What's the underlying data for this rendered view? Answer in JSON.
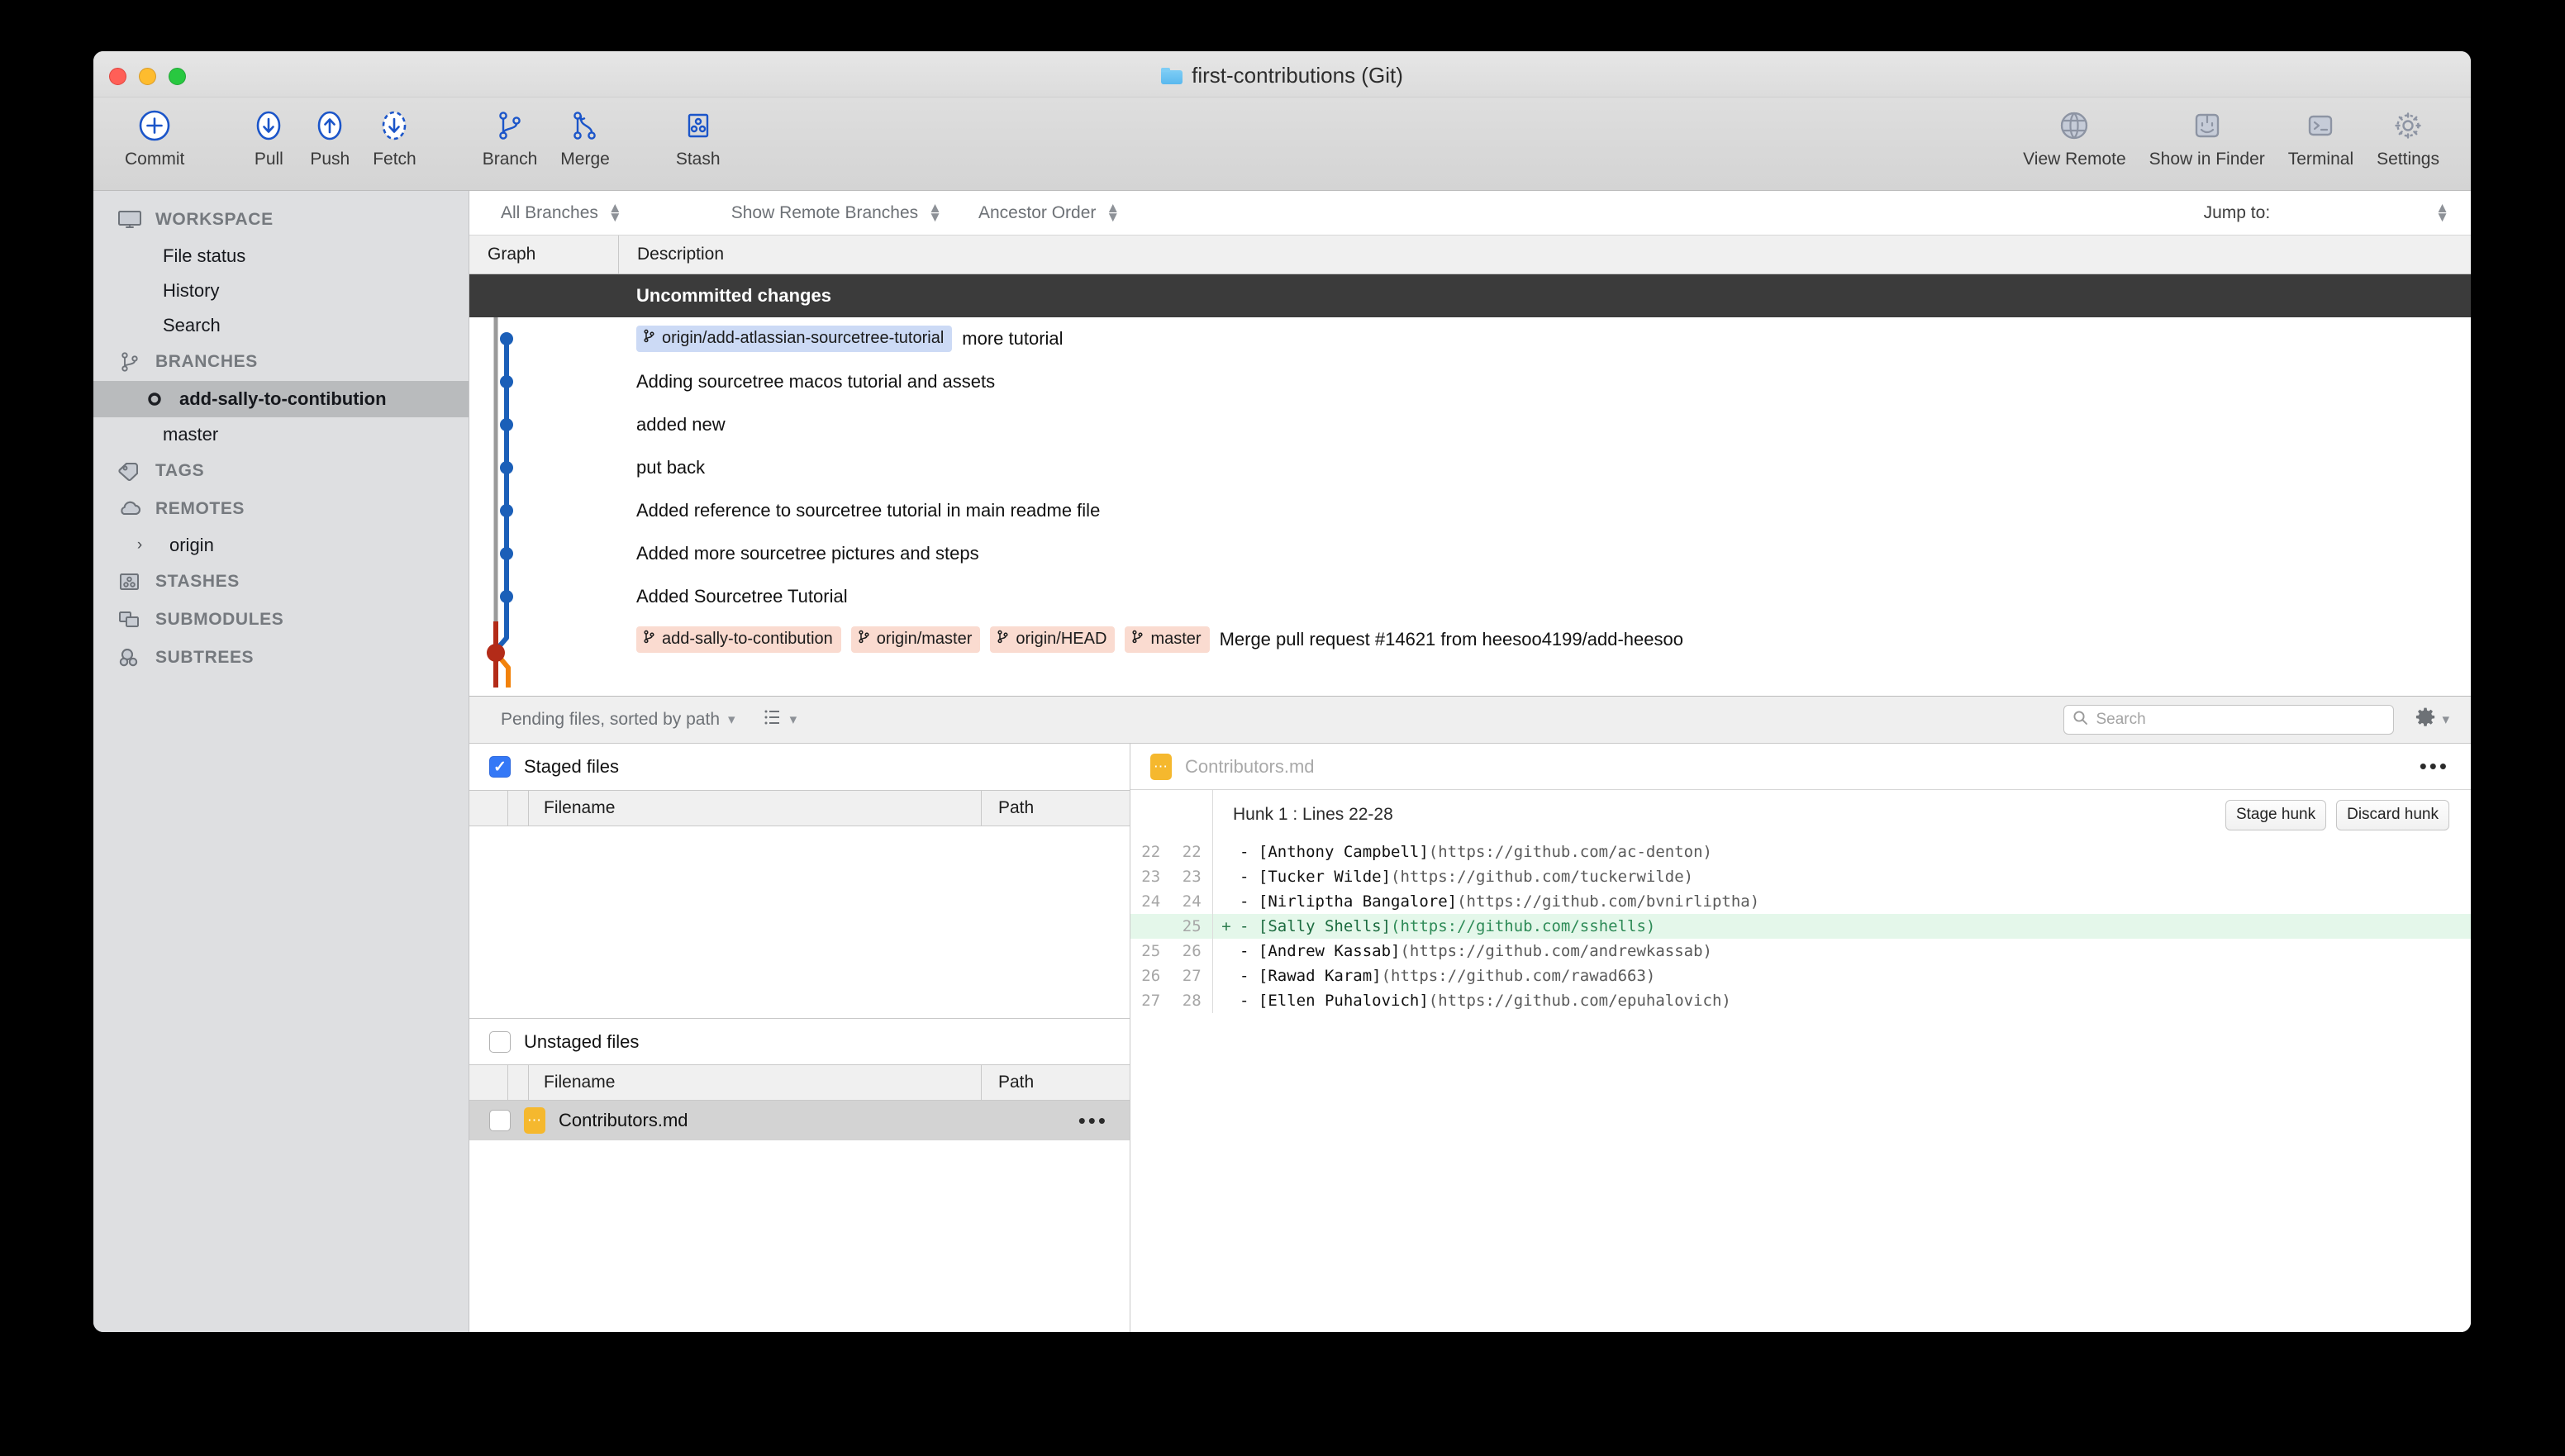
{
  "window": {
    "title": "first-contributions (Git)",
    "folder_icon": "folder-icon"
  },
  "toolbar": {
    "items": [
      {
        "label": "Commit",
        "icon": "commit-plus-circle-icon"
      },
      {
        "label": "Pull",
        "icon": "pull-down-arrow-icon"
      },
      {
        "label": "Push",
        "icon": "push-up-arrow-icon"
      },
      {
        "label": "Fetch",
        "icon": "fetch-dashed-down-arrow-icon"
      },
      {
        "label": "Branch",
        "icon": "branch-icon"
      },
      {
        "label": "Merge",
        "icon": "merge-icon"
      },
      {
        "label": "Stash",
        "icon": "stash-icon"
      }
    ],
    "right_items": [
      {
        "label": "View Remote",
        "icon": "globe-icon"
      },
      {
        "label": "Show in Finder",
        "icon": "finder-icon"
      },
      {
        "label": "Terminal",
        "icon": "terminal-icon"
      },
      {
        "label": "Settings",
        "icon": "gear-icon"
      }
    ]
  },
  "sidebar": {
    "sections": [
      {
        "label": "WORKSPACE",
        "icon": "monitor-icon",
        "items": [
          {
            "label": "File status"
          },
          {
            "label": "History"
          },
          {
            "label": "Search"
          }
        ]
      },
      {
        "label": "BRANCHES",
        "icon": "branch-icon",
        "items": [
          {
            "label": "add-sally-to-contibution",
            "selected": true,
            "icon": "branch-dot-icon"
          },
          {
            "label": "master",
            "selected": false
          }
        ]
      },
      {
        "label": "TAGS",
        "icon": "tag-icon",
        "items": []
      },
      {
        "label": "REMOTES",
        "icon": "cloud-icon",
        "items": [
          {
            "label": "origin",
            "chevron": "›"
          }
        ]
      },
      {
        "label": "STASHES",
        "icon": "stash-icon",
        "items": []
      },
      {
        "label": "SUBMODULES",
        "icon": "submodules-icon",
        "items": []
      },
      {
        "label": "SUBTREES",
        "icon": "subtrees-icon",
        "items": []
      }
    ]
  },
  "filterbar": {
    "branch_filter": "All Branches",
    "remote_filter": "Show Remote Branches",
    "order_filter": "Ancestor Order",
    "jump_to": "Jump to:"
  },
  "graph_columns": {
    "graph": "Graph",
    "description": "Description"
  },
  "commits": [
    {
      "message": "Uncommitted changes",
      "refs": [],
      "header": true
    },
    {
      "message": "more tutorial",
      "refs": [
        {
          "name": "origin/add-atlassian-sourcetree-tutorial",
          "kind": "remote"
        }
      ]
    },
    {
      "message": "Adding sourcetree macos tutorial and assets",
      "refs": []
    },
    {
      "message": "added new",
      "refs": []
    },
    {
      "message": "put back",
      "refs": []
    },
    {
      "message": "Added reference to sourcetree tutorial in main readme file",
      "refs": []
    },
    {
      "message": "Added more sourcetree pictures and steps",
      "refs": []
    },
    {
      "message": "Added Sourcetree Tutorial",
      "refs": []
    },
    {
      "message": "Merge pull request #14621 from heesoo4199/add-heesoo",
      "refs": [
        {
          "name": "add-sally-to-contibution",
          "kind": "local"
        },
        {
          "name": "origin/master",
          "kind": "local"
        },
        {
          "name": "origin/HEAD",
          "kind": "local"
        },
        {
          "name": "master",
          "kind": "local"
        }
      ]
    }
  ],
  "pendingbar": {
    "sort_label": "Pending files, sorted by path",
    "view_icon": "list-view-icon",
    "search_placeholder": "Search",
    "search_value": "",
    "search_icon": "search-icon",
    "gear_icon": "gear-icon"
  },
  "staged": {
    "group_label": "Staged files",
    "checked": true,
    "columns": {
      "filename": "Filename",
      "path": "Path"
    },
    "rows": []
  },
  "unstaged": {
    "group_label": "Unstaged files",
    "checked": false,
    "columns": {
      "filename": "Filename",
      "path": "Path"
    },
    "rows": [
      {
        "filename": "Contributors.md",
        "path": "",
        "checked": false,
        "icon": "markdown-file-icon",
        "menu": "•••"
      }
    ]
  },
  "diff": {
    "filename": "Contributors.md",
    "file_icon": "markdown-file-icon",
    "menu": "•••",
    "hunk_title": "Hunk 1 : Lines 22-28",
    "stage_hunk": "Stage hunk",
    "discard_hunk": "Discard hunk",
    "lines": [
      {
        "old": "22",
        "new": "22",
        "sign": "",
        "name": "- [Anthony Campbell]",
        "url": "(https://github.com/ac-denton)",
        "type": "context"
      },
      {
        "old": "23",
        "new": "23",
        "sign": "",
        "name": "- [Tucker Wilde]",
        "url": "(https://github.com/tuckerwilde)",
        "type": "context"
      },
      {
        "old": "24",
        "new": "24",
        "sign": "",
        "name": "- [Nirliptha Bangalore]",
        "url": "(https://github.com/bvnirliptha)",
        "type": "context"
      },
      {
        "old": "",
        "new": "25",
        "sign": "+",
        "name": "- [Sally Shells]",
        "url": "(https://github.com/sshells)",
        "type": "added"
      },
      {
        "old": "25",
        "new": "26",
        "sign": "",
        "name": "- [Andrew Kassab]",
        "url": "(https://github.com/andrewkassab)",
        "type": "context"
      },
      {
        "old": "26",
        "new": "27",
        "sign": "",
        "name": "- [Rawad Karam]",
        "url": "(https://github.com/rawad663)",
        "type": "context"
      },
      {
        "old": "27",
        "new": "28",
        "sign": "",
        "name": "- [Ellen Puhalovich]",
        "url": "(https://github.com/epuhalovich)",
        "type": "context"
      }
    ]
  },
  "colors": {
    "accent_blue": "#1f5fbf",
    "graph_blue": "#1b5fb8",
    "graph_red": "#b32b18",
    "graph_orange": "#f2820a",
    "added_bg": "#e4f7ea",
    "remote_label_bg": "#ccdaf5",
    "local_label_bg": "#fadbd0",
    "selection_gray": "#b9bbbd"
  }
}
